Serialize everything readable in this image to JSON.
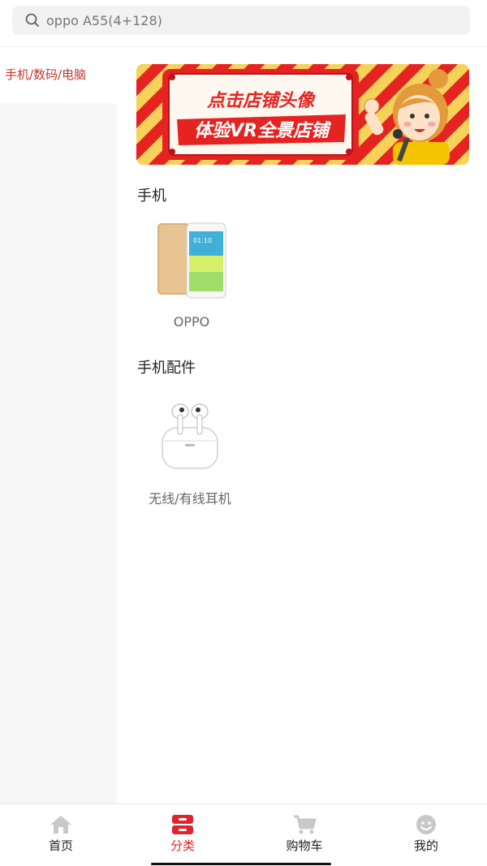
{
  "search": {
    "placeholder": "oppo A55(4+128)",
    "icon": "search-icon"
  },
  "sidebar": {
    "items": [
      {
        "label": "手机/数码/电脑",
        "active": true
      }
    ]
  },
  "banner": {
    "line1": "点击店铺头像",
    "line2": "体验VR全景店铺"
  },
  "sections": [
    {
      "title": "手机",
      "products": [
        {
          "label": "OPPO"
        }
      ]
    },
    {
      "title": "手机配件",
      "products": [
        {
          "label": "无线/有线耳机"
        }
      ]
    }
  ],
  "tabbar": {
    "tabs": [
      {
        "label": "首页",
        "icon": "home-icon",
        "active": false
      },
      {
        "label": "分类",
        "icon": "category-icon",
        "active": true
      },
      {
        "label": "购物车",
        "icon": "cart-icon",
        "active": false
      },
      {
        "label": "我的",
        "icon": "profile-icon",
        "active": false
      }
    ]
  },
  "colors": {
    "accent": "#e0242b",
    "sidebar_active_text": "#c0392b",
    "tab_inactive_icon": "#c8c8c8"
  }
}
